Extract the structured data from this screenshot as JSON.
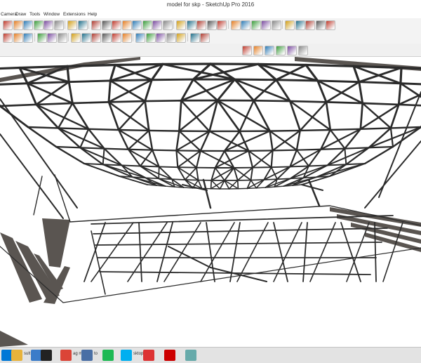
{
  "window": {
    "title": "model for skp - SketchUp Pro 2016"
  },
  "menu": [
    "Camera",
    "Draw",
    "Tools",
    "Window",
    "Extensions",
    "Help"
  ],
  "toolbar1": [
    "select-icon",
    "eraser-icon",
    "paint-bucket-icon",
    "hide-icon",
    "undo-icon",
    "redo-icon",
    "print-icon",
    "model-info-icon",
    "line-icon",
    "freehand-icon",
    "rectangle-icon",
    "rotated-rectangle-icon",
    "circle-icon",
    "polygon-icon",
    "arc-icon",
    "pie-icon",
    "move-icon",
    "push-pull-icon",
    "rotate-icon",
    "follow-me-icon",
    "scale-icon",
    "offset-icon",
    "tape-measure-icon",
    "text-icon",
    "dimension-icon",
    "protractor-icon",
    "axes-icon",
    "3d-text-icon",
    "component-icon",
    "x-ray-icon",
    "shadow-icon"
  ],
  "toolbar2": [
    "style-icon",
    "fog-icon",
    "section-icon",
    "orbit-icon",
    "pan-icon",
    "zoom-icon",
    "zoom-window-icon",
    "zoom-extents-icon",
    "previous-view-icon",
    "walk-icon",
    "look-around-icon",
    "position-camera-icon",
    "sandbox-icon",
    "terrain-icon",
    "stamp-icon",
    "drape-icon",
    "warehouse-icon",
    "extension-icon",
    "layout-icon"
  ],
  "toolbar3": [
    "iso-view-icon",
    "top-view-icon",
    "front-view-icon",
    "right-view-icon",
    "back-view-icon",
    "left-view-icon"
  ],
  "taskbar": [
    {
      "icon": "windows-start-icon",
      "text": ""
    },
    {
      "icon": "folder-icon",
      "text": "sult"
    },
    {
      "icon": "file-icon",
      "text": "ru"
    },
    {
      "icon": "amazon-icon",
      "text": ""
    },
    {
      "icon": "chrome-icon",
      "text": "ag m"
    },
    {
      "icon": "mail-icon",
      "text": "to"
    },
    {
      "icon": "spotify-icon",
      "text": ""
    },
    {
      "icon": "skype-icon",
      "text": "sktop"
    },
    {
      "icon": "sketchup-icon",
      "text": ""
    },
    {
      "icon": "acrobat-icon",
      "text": ""
    },
    {
      "icon": "notepad-icon",
      "text": ""
    }
  ],
  "colors": {
    "frame": "#2b2b2b",
    "shadow": "#5a5551",
    "bg": "#ffffff"
  }
}
